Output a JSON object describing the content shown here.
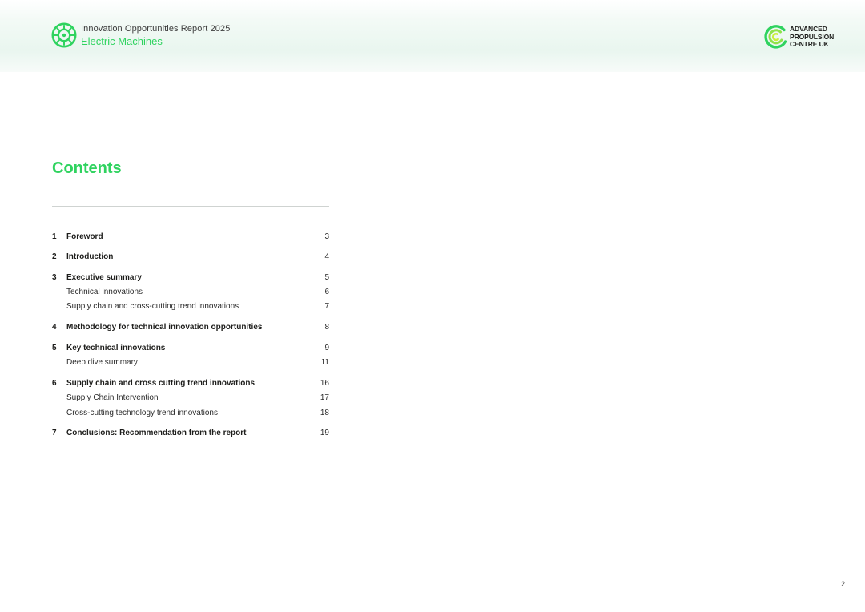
{
  "header": {
    "kicker": "Innovation Opportunities Report 2025",
    "subject": "Electric Machines",
    "logo_icon": "gear-wheel-icon",
    "brand": {
      "name": "ADVANCED PROPULSION CENTRE UK",
      "mark_icon": "swirl-logo-icon",
      "mark_colors": [
        "#2fd35f",
        "#c9ef3b"
      ]
    }
  },
  "contents": {
    "title": "Contents",
    "entries": [
      {
        "number": "1",
        "label": "Foreword",
        "page": "3"
      },
      {
        "number": "2",
        "label": "Introduction",
        "page": "4"
      },
      {
        "number": "3",
        "label": "Executive summary",
        "page": "5",
        "children": [
          {
            "label": "Technical innovations",
            "page": "6"
          },
          {
            "label": "Supply chain and cross-cutting trend innovations",
            "page": "7"
          }
        ]
      },
      {
        "number": "4",
        "label": "Methodology for technical innovation opportunities",
        "page": "8"
      },
      {
        "number": "5",
        "label": "Key technical innovations",
        "page": "9",
        "children": [
          {
            "label": "Deep dive summary",
            "page": "11"
          }
        ]
      },
      {
        "number": "6",
        "label": "Supply chain and cross cutting trend innovations",
        "page": "16",
        "children": [
          {
            "label": "Supply Chain Intervention",
            "page": "17"
          },
          {
            "label": "Cross-cutting technology trend innovations",
            "page": "18"
          }
        ]
      },
      {
        "number": "7",
        "label": "Conclusions: Recommendation from the report",
        "page": "19"
      }
    ]
  },
  "page_number": "2",
  "colors": {
    "accent": "#2fd35f",
    "text": "#1d1d1b",
    "rule": "#cfd3d1"
  }
}
